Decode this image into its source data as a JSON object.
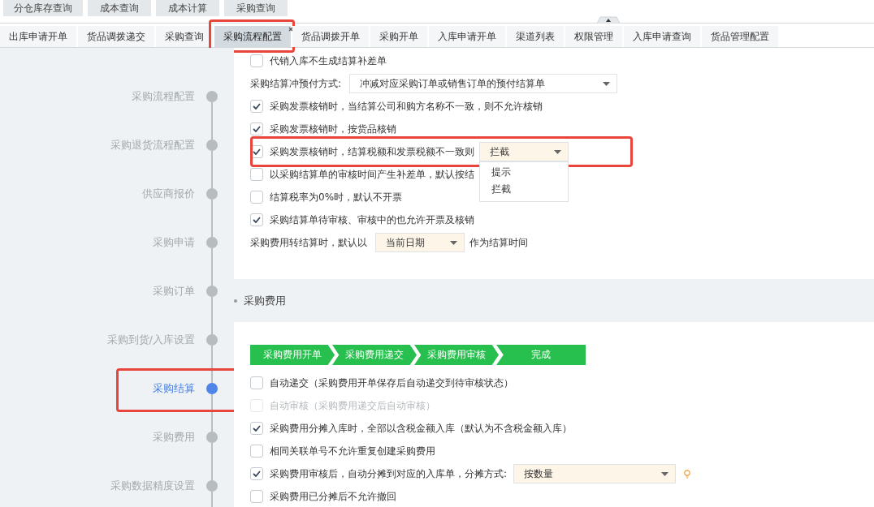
{
  "top_tabs": [
    "分仓库存查询",
    "成本查询",
    "成本计算",
    "采购查询"
  ],
  "tabs": [
    {
      "label": "出库申请开单",
      "selected": false,
      "highlighted": false
    },
    {
      "label": "货品调拨递交",
      "selected": false,
      "highlighted": false
    },
    {
      "label": "采购查询",
      "selected": false,
      "highlighted": false
    },
    {
      "label": "采购流程配置",
      "selected": true,
      "highlighted": true
    },
    {
      "label": "货品调拨开单",
      "selected": false,
      "highlighted": false
    },
    {
      "label": "采购开单",
      "selected": false,
      "highlighted": false
    },
    {
      "label": "入库申请开单",
      "selected": false,
      "highlighted": false
    },
    {
      "label": "渠道列表",
      "selected": false,
      "highlighted": false
    },
    {
      "label": "权限管理",
      "selected": false,
      "highlighted": false
    },
    {
      "label": "入库申请查询",
      "selected": false,
      "highlighted": false
    },
    {
      "label": "货品管理配置",
      "selected": false,
      "highlighted": false
    }
  ],
  "sidebar": {
    "items": [
      {
        "label": "采购流程配置",
        "selected": false,
        "highlighted": false
      },
      {
        "label": "采购退货流程配置",
        "selected": false,
        "highlighted": false
      },
      {
        "label": "供应商报价",
        "selected": false,
        "highlighted": false
      },
      {
        "label": "采购申请",
        "selected": false,
        "highlighted": false
      },
      {
        "label": "采购订单",
        "selected": false,
        "highlighted": false
      },
      {
        "label": "采购到货/入库设置",
        "selected": false,
        "highlighted": false
      },
      {
        "label": "采购结算",
        "selected": true,
        "highlighted": true
      },
      {
        "label": "采购费用",
        "selected": false,
        "highlighted": false
      },
      {
        "label": "采购数据精度设置",
        "selected": false,
        "highlighted": false
      }
    ]
  },
  "settlement_rows": [
    {
      "kind": "checkbox",
      "label": "代销入库不生成结算补差单",
      "checked": false,
      "disabled": false
    },
    {
      "kind": "select",
      "label": "采购结算冲预付方式:",
      "value": "冲减对应采购订单或销售订单的预付结算单"
    },
    {
      "kind": "checkbox",
      "label": "采购发票核销时，当结算公司和购方名称不一致，则不允许核销",
      "checked": true,
      "disabled": false
    },
    {
      "kind": "checkbox",
      "label": "采购发票核销时，按货品核销",
      "checked": true,
      "disabled": false
    },
    {
      "kind": "checkbox_select",
      "label": "采购发票核销时，结算税额和发票税额不一致则",
      "checked": true,
      "disabled": false,
      "value": "拦截",
      "highlighted": true,
      "open": true,
      "options": [
        "提示",
        "拦截"
      ]
    },
    {
      "kind": "checkbox",
      "label": "以采购结算单的审核时间产生补差单，默认按结",
      "checked": false,
      "disabled": false
    },
    {
      "kind": "checkbox",
      "label": "结算税率为0%时，默认不开票",
      "checked": false,
      "disabled": false
    },
    {
      "kind": "checkbox",
      "label": "采购结算单待审核、审核中的也允许开票及核销",
      "checked": true,
      "disabled": false
    },
    {
      "kind": "inline_select",
      "label": "采购费用转结算时，默认以",
      "value": "当前日期",
      "suffix": "作为结算时间"
    }
  ],
  "fee_section": {
    "title": "采购费用",
    "steps": [
      "采购费用开单",
      "采购费用递交",
      "采购费用审核",
      "完成"
    ],
    "rows": [
      {
        "kind": "checkbox",
        "label": "自动递交（采购费用开单保存后自动递交到待审核状态）",
        "checked": false,
        "disabled": false
      },
      {
        "kind": "checkbox",
        "label": "自动审核（采购费用递交后自动审核）",
        "checked": false,
        "disabled": true
      },
      {
        "kind": "checkbox",
        "label": "采购费用分摊入库时，全部以含税金额入库（默认为不含税金额入库）",
        "checked": true,
        "disabled": false
      },
      {
        "kind": "checkbox",
        "label": "相同关联单号不允许重复创建采购费用",
        "checked": false,
        "disabled": false
      },
      {
        "kind": "checkbox_select",
        "label": "采购费用审核后，自动分摊到对应的入库单，分摊方式:",
        "checked": true,
        "disabled": false,
        "value": "按数量",
        "hint": true
      },
      {
        "kind": "checkbox",
        "label": "采购费用已分摊后不允许撤回",
        "checked": false,
        "disabled": false
      }
    ]
  }
}
